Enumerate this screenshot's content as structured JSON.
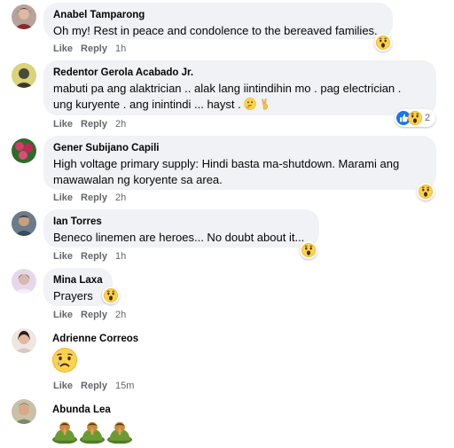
{
  "comments": [
    {
      "author": "Anabel Tamparong",
      "text": "Oh my! Rest in peace and condolence to the bereaved families.",
      "like": "Like",
      "reply": "Reply",
      "time": "1h",
      "reaction": "wow-icon"
    },
    {
      "author": "Redentor Gerola Acabado Jr.",
      "text_line1": "mabuti pa ang alaktrician .. alak lang iintindihin mo . pag electrician .",
      "text_line2": "ung kuryente . ang inintindi ... hayst .",
      "trailing_emoji": [
        "thinking-face-icon",
        "victory-hand-icon"
      ],
      "like": "Like",
      "reply": "Reply",
      "time": "2h",
      "reaction_count": "2",
      "reactions": [
        "like-icon",
        "wow-icon"
      ]
    },
    {
      "author": "Gener Subijano Capili",
      "text_line1": "High voltage primary supply: Hindi basta ma-shutdown. Marami ang",
      "text_line2": "mawawalan ng koryente sa area.",
      "like": "Like",
      "reply": "Reply",
      "time": "2h",
      "reaction": "wow-icon"
    },
    {
      "author": "Ian Torres",
      "text": "Beneco linemen are heroes... No doubt about it...",
      "like": "Like",
      "reply": "Reply",
      "time": "1h",
      "reaction": "wow-icon"
    },
    {
      "author": "Mina Laxa",
      "text": "Prayers",
      "like": "Like",
      "reply": "Reply",
      "time": "2h",
      "reaction": "wow-icon"
    },
    {
      "author": "Adrienne Correos",
      "emoji": "sad-face-icon",
      "like": "Like",
      "reply": "Reply",
      "time": "15m"
    },
    {
      "author": "Abunda Lea",
      "emoji": [
        "praying-person-icon",
        "praying-person-icon",
        "praying-person-icon"
      ]
    }
  ],
  "colors": {
    "bubble": "#f0f2f5",
    "meta": "#65676b",
    "like_blue": "#1877f2",
    "wow_yellow": "#f7b125"
  }
}
